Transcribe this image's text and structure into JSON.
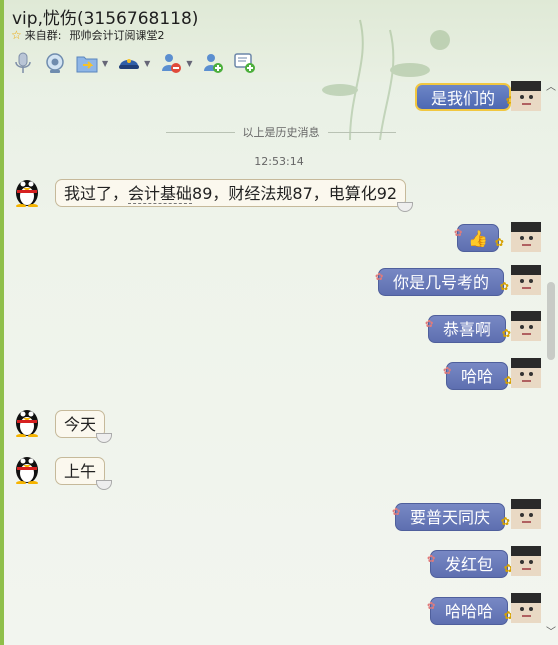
{
  "window": {
    "title": "vip,忧伤(3156768118)",
    "source_prefix": "来自群:",
    "source_group": "邢帅会计订阅课堂2"
  },
  "toolbar": {
    "icons": [
      "microphone-icon",
      "video-camera-icon",
      "folder-send-icon",
      "app-hat-icon",
      "remove-contact-icon",
      "add-contact-icon",
      "message-add-icon"
    ]
  },
  "history": {
    "divider_text": "以上是历史消息",
    "timestamp": "12:53:14"
  },
  "messages": [
    {
      "side": "right",
      "text": "是我们的"
    },
    {
      "side": "left",
      "text_prefix": "我过了，",
      "text_underlined": "会计基础",
      "text_suffix": "89，财经法规87，电算化92"
    },
    {
      "side": "right",
      "text": "👍"
    },
    {
      "side": "right",
      "text": "你是几号考的"
    },
    {
      "side": "right",
      "text": "恭喜啊"
    },
    {
      "side": "right",
      "text": "哈哈"
    },
    {
      "side": "left",
      "text": "今天"
    },
    {
      "side": "left",
      "text": "上午"
    },
    {
      "side": "right",
      "text": "要普天同庆"
    },
    {
      "side": "right",
      "text": "发红包"
    },
    {
      "side": "right",
      "text": "哈哈哈"
    }
  ],
  "colors": {
    "accent_green": "#8fbf4a",
    "bubble_blue": "#5e6fb0",
    "bubble_gold_border": "#f1c740"
  }
}
